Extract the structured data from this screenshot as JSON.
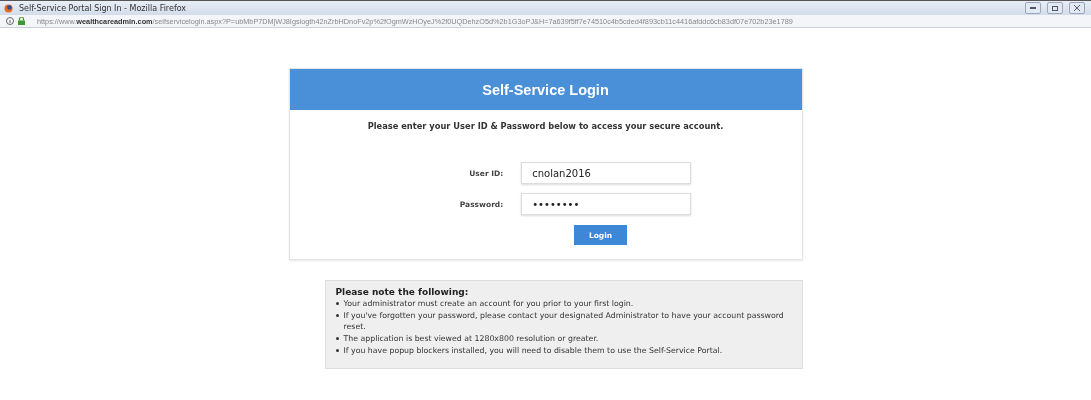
{
  "window": {
    "title": "Self-Service Portal Sign In - Mozilla Firefox",
    "url": "https://www.**wealthcareadmin.com**/selfservicelogin.aspx?P=ubMbP7DMjWJ8Igsiogth42nZrbHDnoFv2p%2fOgmWzHOyeJ%2f0UQDehzO5d%2b1G3oPJ&H=7a639f5ff7e74510c4b5cded4f893cb11c4416afddc6cb83df07e702b23e1789"
  },
  "login": {
    "title": "Self-Service Login",
    "intro": "Please enter your User ID & Password below to access your secure account.",
    "fields": [
      {
        "label": "User ID:",
        "value": "cnolan2016"
      },
      {
        "label": "Password:",
        "value": "••••••••"
      }
    ],
    "button": "Login"
  },
  "notes": {
    "heading": "Please note the following:",
    "items": [
      "Your administrator must create an account for you prior to your first login.",
      "If you've forgotten your password, please contact your designated Administrator to have your account password reset.",
      "The application is best viewed at 1280x800 resolution or greater.",
      "If you have popup blockers installed, you will need to disable them to use the Self-Service Portal."
    ]
  }
}
